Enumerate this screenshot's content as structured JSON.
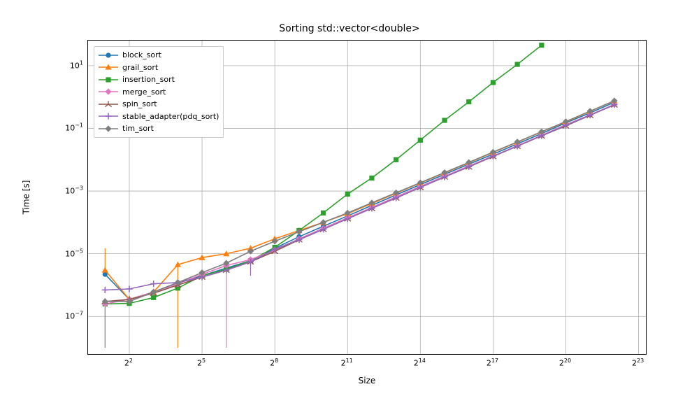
{
  "chart_data": {
    "type": "line",
    "title": "Sorting std::vector<double>",
    "xlabel": "Size",
    "ylabel": "Time [s]",
    "x_scale": "log2",
    "y_scale": "log10",
    "xlim_exp2": [
      0.3,
      23.3
    ],
    "ylim_exp10": [
      -8.2,
      1.8
    ],
    "x_ticks_exp2": [
      2,
      5,
      8,
      11,
      14,
      17,
      20,
      23
    ],
    "y_ticks_exp10": [
      -7,
      -5,
      -3,
      -1,
      1
    ],
    "x_exp2": [
      1,
      2,
      3,
      4,
      5,
      6,
      7,
      8,
      9,
      10,
      11,
      12,
      13,
      14,
      15,
      16,
      17,
      18,
      19,
      20,
      21,
      22
    ],
    "series": [
      {
        "name": "block_sort",
        "color": "#1f77b4",
        "marker": "circle",
        "y": [
          2.2e-06,
          3.5e-07,
          6e-07,
          1.2e-06,
          2e-06,
          3.5e-06,
          6e-06,
          1.5e-05,
          3.5e-05,
          7.5e-05,
          0.00016,
          0.00035,
          0.00075,
          0.0016,
          0.0034,
          0.0072,
          0.015,
          0.032,
          0.068,
          0.15,
          0.31,
          0.68
        ]
      },
      {
        "name": "grail_sort",
        "color": "#ff7f0e",
        "marker": "triangle",
        "y": [
          3e-06,
          3.5e-07,
          6e-07,
          4.5e-06,
          7.5e-06,
          1e-05,
          1.5e-05,
          3e-05,
          5.5e-05,
          0.0001,
          0.00019,
          0.0004,
          0.00085,
          0.0018,
          0.0038,
          0.008,
          0.017,
          0.036,
          0.077,
          0.16,
          0.35,
          0.75
        ]
      },
      {
        "name": "insertion_sort",
        "color": "#2ca02c",
        "marker": "square",
        "y": [
          2.5e-07,
          2.6e-07,
          4e-07,
          8e-07,
          2e-06,
          3.2e-06,
          6e-06,
          1.6e-05,
          5.5e-05,
          0.0002,
          0.0008,
          0.0026,
          0.01,
          0.042,
          0.18,
          0.7,
          2.9,
          11.0,
          45.0,
          null,
          null,
          null
        ]
      },
      {
        "name": "merge_sort",
        "color": "#e377c2",
        "marker": "diamond",
        "y": [
          2.5e-07,
          3.5e-07,
          6e-07,
          1.1e-06,
          2.2e-06,
          4.2e-06,
          6.5e-06,
          1.3e-05,
          3e-05,
          6.5e-05,
          0.00014,
          0.0003,
          0.00065,
          0.0014,
          0.003,
          0.0063,
          0.013,
          0.028,
          0.06,
          0.13,
          0.27,
          0.58
        ]
      },
      {
        "name": "spin_sort",
        "color": "#8c564b",
        "marker": "tri-down",
        "y": [
          3e-07,
          3.5e-07,
          5.5e-07,
          1e-06,
          1.8e-06,
          3e-06,
          5.5e-06,
          1.2e-05,
          2.8e-05,
          6e-05,
          0.00013,
          0.00028,
          0.0006,
          0.0013,
          0.0028,
          0.0059,
          0.0127,
          0.027,
          0.0575,
          0.12,
          0.26,
          0.56
        ]
      },
      {
        "name": "stable_adapter(pdq_sort)",
        "color": "#9467bd",
        "marker": "plus",
        "y": [
          7e-07,
          7.5e-07,
          1.1e-06,
          1.2e-06,
          1.8e-06,
          3e-06,
          5.5e-06,
          1.4e-05,
          2.8e-05,
          6e-05,
          0.00013,
          0.00028,
          0.0006,
          0.0013,
          0.0028,
          0.006,
          0.013,
          0.027,
          0.058,
          0.125,
          0.265,
          0.57
        ]
      },
      {
        "name": "tim_sort",
        "color": "#7f7f7f",
        "marker": "diamond",
        "y": [
          3e-07,
          3e-07,
          6e-07,
          1.2e-06,
          2.5e-06,
          5e-06,
          1.2e-05,
          2.5e-05,
          5e-05,
          0.0001,
          0.0002,
          0.00042,
          0.00088,
          0.00185,
          0.0039,
          0.0082,
          0.0175,
          0.037,
          0.078,
          0.165,
          0.355,
          0.76
        ]
      }
    ],
    "error_spikes": [
      {
        "series": "tim_sort",
        "x_exp2": 1,
        "y_low": 1e-08
      },
      {
        "series": "grail_sort",
        "x_exp2": 1,
        "y_high": 1.5e-05
      },
      {
        "series": "grail_sort",
        "x_exp2": 4,
        "y_low": 1e-08
      },
      {
        "series": "merge_sort",
        "x_exp2": 6,
        "y_low": 1e-08
      },
      {
        "series": "stable_adapter(pdq_sort)",
        "x_exp2": 7,
        "y_low": 2e-06
      }
    ]
  }
}
